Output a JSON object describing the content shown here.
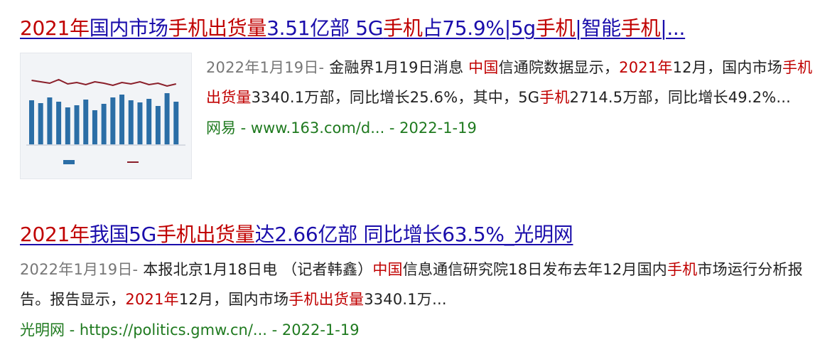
{
  "result1": {
    "title_parts": [
      {
        "t": "2021年",
        "hl": true
      },
      {
        "t": "国内市场",
        "hl": false
      },
      {
        "t": "手机出货量",
        "hl": true
      },
      {
        "t": "3.51亿部 5G",
        "hl": false
      },
      {
        "t": "手机",
        "hl": true
      },
      {
        "t": "占75.9%|5g",
        "hl": false
      },
      {
        "t": "手机",
        "hl": true
      },
      {
        "t": "|智能",
        "hl": false
      },
      {
        "t": "手机",
        "hl": true
      },
      {
        "t": "|...",
        "hl": false
      }
    ],
    "date": "2022年1月19日- ",
    "snippet_parts": [
      {
        "t": "金融界1月19日消息 ",
        "hl": false
      },
      {
        "t": "中国",
        "hl": true
      },
      {
        "t": "信通院数据显示，",
        "hl": false
      },
      {
        "t": "2021年",
        "hl": true
      },
      {
        "t": "12月，国内市场",
        "hl": false
      },
      {
        "t": "手机出货量",
        "hl": true
      },
      {
        "t": "3340.1万部，同比增长25.6%，其中，5G",
        "hl": false
      },
      {
        "t": "手机",
        "hl": true
      },
      {
        "t": "2714.5万部，同比增长49.2%...",
        "hl": false
      }
    ],
    "source": "网易 - www.163.com/d... - 2022-1-19"
  },
  "result2": {
    "title_parts": [
      {
        "t": "2021年",
        "hl": true
      },
      {
        "t": "我国5G",
        "hl": false
      },
      {
        "t": "手机出货量",
        "hl": true
      },
      {
        "t": "达2.66亿部 同比增长63.5%_光明网",
        "hl": false
      }
    ],
    "date": "2022年1月19日- ",
    "snippet_parts": [
      {
        "t": "本报北京1月18日电 （记者韩鑫）",
        "hl": false
      },
      {
        "t": "中国",
        "hl": true
      },
      {
        "t": "信息通信研究院18日发布去年12月国内",
        "hl": false
      },
      {
        "t": "手机",
        "hl": true
      },
      {
        "t": "市场运行分析报告。报告显示，",
        "hl": false
      },
      {
        "t": "2021年",
        "hl": true
      },
      {
        "t": "12月，国内市场",
        "hl": false
      },
      {
        "t": "手机出货量",
        "hl": true
      },
      {
        "t": "3340.1万...",
        "hl": false
      }
    ],
    "source": "光明网 - https://politics.gmw.cn/... - 2022-1-19"
  },
  "thumbnail": {
    "bars": [
      0.62,
      0.58,
      0.66,
      0.6,
      0.52,
      0.55,
      0.63,
      0.48,
      0.57,
      0.66,
      0.7,
      0.62,
      0.59,
      0.64,
      0.54,
      0.72,
      0.6
    ],
    "line": [
      0.82,
      0.8,
      0.78,
      0.83,
      0.77,
      0.79,
      0.76,
      0.8,
      0.78,
      0.75,
      0.79,
      0.77,
      0.8,
      0.76,
      0.78,
      0.74,
      0.77
    ],
    "colors": {
      "bar": "#2b6ea6",
      "line": "#8a1f2a"
    }
  }
}
